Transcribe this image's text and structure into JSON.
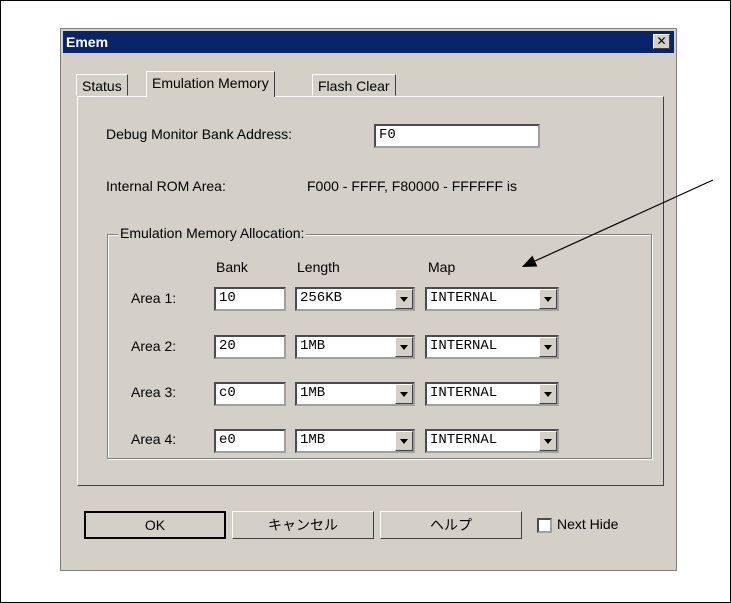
{
  "window": {
    "title": "Emem",
    "close_glyph": "✕"
  },
  "tabs": [
    {
      "label": "Status"
    },
    {
      "label": "Emulation Memory",
      "active": true
    },
    {
      "label": "Flash Clear"
    }
  ],
  "debug_monitor": {
    "label": "Debug Monitor Bank Address:",
    "value": "F0"
  },
  "internal_rom": {
    "label": "Internal ROM Area:",
    "value": "F000 - FFFF, F80000 - FFFFFF is"
  },
  "allocation": {
    "title": "Emulation Memory Allocation:",
    "headers": {
      "bank": "Bank",
      "length": "Length",
      "map": "Map"
    },
    "rows": [
      {
        "label": "Area 1:",
        "bank": "10",
        "length": "256KB",
        "map": "INTERNAL"
      },
      {
        "label": "Area 2:",
        "bank": "20",
        "length": "1MB",
        "map": "INTERNAL"
      },
      {
        "label": "Area 3:",
        "bank": "c0",
        "length": "1MB",
        "map": "INTERNAL"
      },
      {
        "label": "Area 4:",
        "bank": "e0",
        "length": "1MB",
        "map": "INTERNAL"
      }
    ]
  },
  "buttons": {
    "ok": "OK",
    "cancel": "キャンセル",
    "help": "ヘルプ"
  },
  "next_hide": {
    "label": "Next Hide",
    "checked": false
  }
}
